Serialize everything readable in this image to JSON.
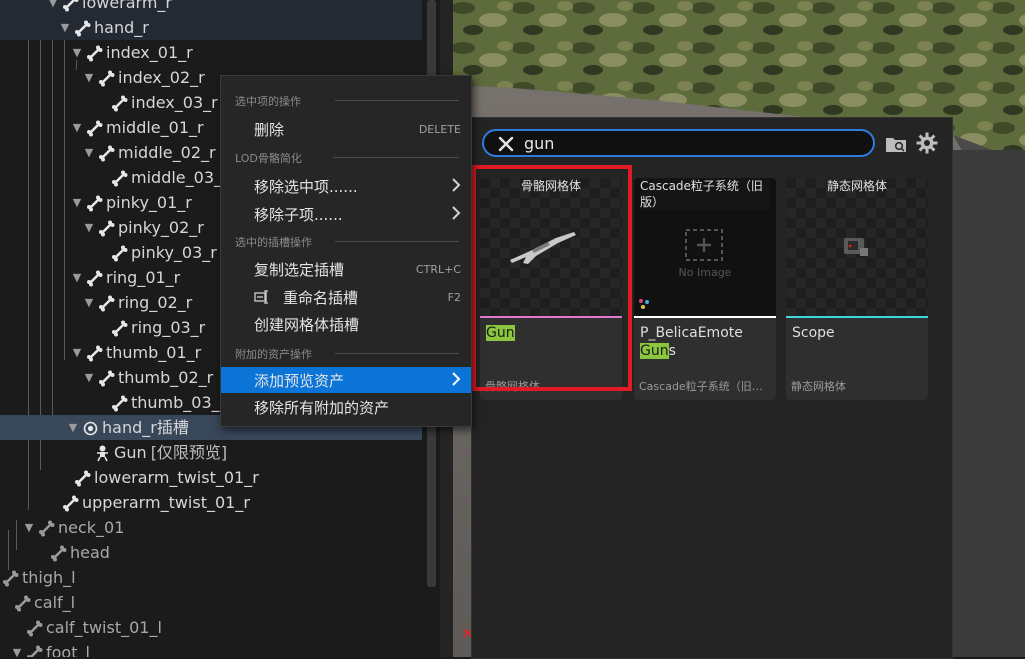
{
  "tree": {
    "rows": [
      {
        "label": "lowerarm_r",
        "indent": 60,
        "arrow": true,
        "dim": false
      },
      {
        "label": "hand_r",
        "indent": 72,
        "arrow": true,
        "dim": false
      },
      {
        "label": "index_01_r",
        "indent": 84,
        "arrow": true,
        "dim": false
      },
      {
        "label": "index_02_r",
        "indent": 96,
        "arrow": true,
        "dim": false
      },
      {
        "label": "index_03_r",
        "indent": 109,
        "arrow": false,
        "dim": false
      },
      {
        "label": "middle_01_r",
        "indent": 84,
        "arrow": true,
        "dim": false
      },
      {
        "label": "middle_02_r",
        "indent": 96,
        "arrow": true,
        "dim": false
      },
      {
        "label": "middle_03_r",
        "indent": 109,
        "arrow": false,
        "dim": false
      },
      {
        "label": "pinky_01_r",
        "indent": 84,
        "arrow": true,
        "dim": false
      },
      {
        "label": "pinky_02_r",
        "indent": 96,
        "arrow": true,
        "dim": false
      },
      {
        "label": "pinky_03_r",
        "indent": 109,
        "arrow": false,
        "dim": false
      },
      {
        "label": "ring_01_r",
        "indent": 84,
        "arrow": true,
        "dim": false
      },
      {
        "label": "ring_02_r",
        "indent": 96,
        "arrow": true,
        "dim": false
      },
      {
        "label": "ring_03_r",
        "indent": 109,
        "arrow": false,
        "dim": false
      },
      {
        "label": "thumb_01_r",
        "indent": 84,
        "arrow": true,
        "dim": false
      },
      {
        "label": "thumb_02_r",
        "indent": 96,
        "arrow": true,
        "dim": false
      },
      {
        "label": "thumb_03_r",
        "indent": 109,
        "arrow": false,
        "dim": false
      },
      {
        "label": "hand_r插槽",
        "indent": 80,
        "arrow": true,
        "dim": false,
        "socket": true
      },
      {
        "label": "Gun",
        "indent": 92,
        "arrow": false,
        "dim": false,
        "mesh": true,
        "tag": "[仅限预览]"
      },
      {
        "label": "lowerarm_twist_01_r",
        "indent": 72,
        "arrow": false,
        "dim": false
      },
      {
        "label": "upperarm_twist_01_r",
        "indent": 60,
        "arrow": false,
        "dim": false
      },
      {
        "label": "neck_01",
        "indent": 36,
        "arrow": true,
        "dim": true
      },
      {
        "label": "head",
        "indent": 48,
        "arrow": false,
        "dim": true
      },
      {
        "label": "thigh_l",
        "indent": 0,
        "arrow": false,
        "dim": true
      },
      {
        "label": "calf_l",
        "indent": 12,
        "arrow": false,
        "dim": true
      },
      {
        "label": "calf_twist_01_l",
        "indent": 24,
        "arrow": false,
        "dim": true
      },
      {
        "label": "foot_l",
        "indent": 24,
        "arrow": true,
        "dim": true
      }
    ]
  },
  "menu": {
    "sec_selected": "选中项的操作",
    "delete_label": "删除",
    "delete_shortcut": "DELETE",
    "sec_lod": "LOD骨骼简化",
    "remove_selected": "移除选中项......",
    "remove_children": "移除子项......",
    "sec_socket": "选中的插槽操作",
    "copy_socket": "复制选定插槽",
    "copy_shortcut": "CTRL+C",
    "rename_socket": "重命名插槽",
    "rename_shortcut": "F2",
    "create_mesh_socket": "创建网格体插槽",
    "sec_assets": "附加的资产操作",
    "add_preview_asset": "添加预览资产",
    "remove_all_assets": "移除所有附加的资产"
  },
  "picker": {
    "search_value": "gun",
    "cards": [
      {
        "type": "骨骼网格体",
        "name_hl": "Gun",
        "name_rest": "",
        "name_prefix": "",
        "sub": "骨骼网格体",
        "stripe": "#e07ad0"
      },
      {
        "type": "Cascade粒子系统（旧版）",
        "name_prefix": "P_BelicaEmote",
        "name_hl": "Gun",
        "name_rest": "s",
        "sub": "Cascade粒子系统（旧版）",
        "stripe": "#ffffff",
        "no_image": "No Image"
      },
      {
        "type": "静态网格体",
        "name_prefix": "Scope",
        "name_hl": "",
        "name_rest": "",
        "sub": "静态网格体",
        "stripe": "#3fd6e0"
      }
    ]
  },
  "colors": {
    "accent": "#0b74d6",
    "highlight_match": "#8cc63f",
    "annotation_box": "#e01b24",
    "selected_row": "#38475a"
  }
}
